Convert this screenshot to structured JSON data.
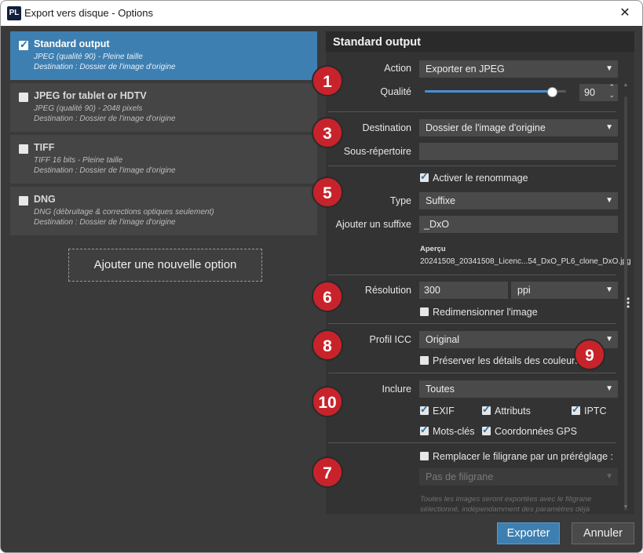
{
  "window": {
    "logo": "PL",
    "title": "Export vers disque - Options",
    "close_glyph": "✕"
  },
  "presets": [
    {
      "title": "Standard output",
      "line1": "JPEG (qualité 90) - Pleine taille",
      "line2": "Destination : Dossier de l'image d'origine",
      "checked": true,
      "selected": true
    },
    {
      "title": "JPEG for tablet or HDTV",
      "line1": "JPEG (qualité 90) - 2048 pixels",
      "line2": "Destination : Dossier de l'image d'origine",
      "checked": false,
      "selected": false
    },
    {
      "title": "TIFF",
      "line1": "TIFF 16 bits - Pleine taille",
      "line2": "Destination : Dossier de l'image d'origine",
      "checked": false,
      "selected": false
    },
    {
      "title": "DNG",
      "line1": "DNG (débruitage & corrections optiques seulement)",
      "line2": "Destination : Dossier de l'image d'origine",
      "checked": false,
      "selected": false
    }
  ],
  "add_option_label": "Ajouter une nouvelle option",
  "panel": {
    "title": "Standard output",
    "action": {
      "label": "Action",
      "value": "Exporter en JPEG"
    },
    "quality": {
      "label": "Qualité",
      "value": "90",
      "fraction": 0.9
    },
    "destination": {
      "label": "Destination",
      "value": "Dossier de l'image d'origine"
    },
    "subfolder": {
      "label": "Sous-répertoire",
      "value": ""
    },
    "rename": {
      "label": "Activer le renommage",
      "checked": true
    },
    "type": {
      "label": "Type",
      "value": "Suffixe"
    },
    "suffix": {
      "label": "Ajouter un suffixe",
      "value": "_DxO"
    },
    "preview": {
      "label": "Aperçu",
      "value": "20241508_20341508_Licenc...54_DxO_PL6_clone_DxO.jpg"
    },
    "resolution": {
      "label": "Résolution",
      "value": "300",
      "unit": "ppi"
    },
    "resize": {
      "label": "Redimensionner l'image",
      "checked": false
    },
    "icc": {
      "label": "Profil ICC",
      "value": "Original"
    },
    "preserve_colors": {
      "label": "Préserver les détails des couleurs",
      "checked": false
    },
    "include": {
      "label": "Inclure",
      "value": "Toutes"
    },
    "meta": {
      "exif": "EXIF",
      "attributs": "Attributs",
      "iptc": "IPTC",
      "motscles": "Mots-clés",
      "gps": "Coordonnées GPS"
    },
    "watermark": {
      "label": "Remplacer le filigrane par un préréglage :",
      "checked": false,
      "value": "Pas de filigrane"
    },
    "note": "Toutes les images seront exportées avec le filigrane sélectionné, indépendamment des paramètres déjà existants."
  },
  "badges": {
    "b1": "1",
    "b3": "3",
    "b5": "5",
    "b6": "6",
    "b8": "8",
    "b9": "9",
    "b10": "10",
    "b7": "7"
  },
  "buttons": {
    "export": "Exporter",
    "cancel": "Annuler"
  },
  "colors": {
    "accent": "#3e7fb1",
    "badge": "#c8232b",
    "slider_fill": "#4a8fd0",
    "slider_rest": "#5a5a5a"
  },
  "icons": {
    "dropdown": "▼",
    "spin_up": "⌃",
    "spin_down": "⌄",
    "scroll_up": "▲",
    "scroll_down": "▼",
    "splitter": "•\n•\n•"
  }
}
